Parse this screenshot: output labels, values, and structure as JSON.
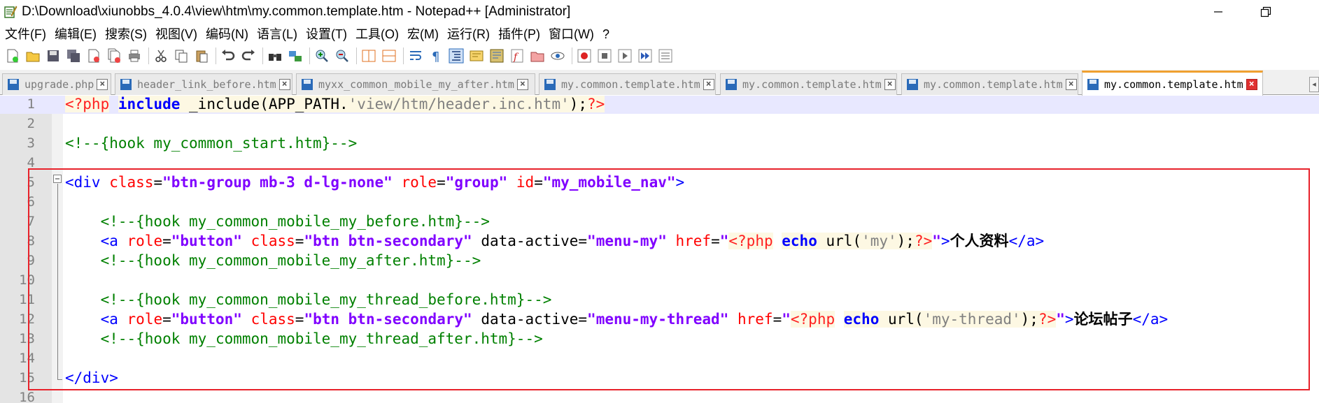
{
  "window": {
    "title": "D:\\Download\\xiunobbs_4.0.4\\view\\htm\\my.common.template.htm - Notepad++ [Administrator]"
  },
  "menu": [
    {
      "label": "文件(F)"
    },
    {
      "label": "编辑(E)"
    },
    {
      "label": "搜索(S)"
    },
    {
      "label": "视图(V)"
    },
    {
      "label": "编码(N)"
    },
    {
      "label": "语言(L)"
    },
    {
      "label": "设置(T)"
    },
    {
      "label": "工具(O)"
    },
    {
      "label": "宏(M)"
    },
    {
      "label": "运行(R)"
    },
    {
      "label": "插件(P)"
    },
    {
      "label": "窗口(W)"
    },
    {
      "label": "?"
    }
  ],
  "tabs": [
    {
      "label": "upgrade.php"
    },
    {
      "label": "header_link_before.htm"
    },
    {
      "label": "myxx_common_mobile_my_after.htm"
    },
    {
      "label": "my.common.template.htm"
    },
    {
      "label": "my.common.template.htm"
    },
    {
      "label": "my.common.template.htm"
    },
    {
      "label": "my.common.template.htm"
    }
  ],
  "tab_close_glyph": "×",
  "tab_scroll_glyph": "◂",
  "editor": {
    "current_line": 1,
    "lines": [
      {
        "num": "1",
        "tokens": [
          {
            "t": "php",
            "v": "<?php"
          },
          {
            "t": "plain",
            "v": " "
          },
          {
            "t": "kw",
            "v": "include"
          },
          {
            "t": "fn",
            "v": " _include"
          },
          {
            "t": "paren",
            "v": "("
          },
          {
            "t": "fn",
            "v": "APP_PATH"
          },
          {
            "t": "paren",
            "v": "."
          },
          {
            "t": "str",
            "v": "'view/htm/header.inc.htm'"
          },
          {
            "t": "paren",
            "v": ");"
          },
          {
            "t": "php",
            "v": "?>"
          }
        ]
      },
      {
        "num": "2",
        "tokens": []
      },
      {
        "num": "3",
        "tokens": [
          {
            "t": "cmt",
            "v": "<!--{hook my_common_start.htm}-->"
          }
        ]
      },
      {
        "num": "4",
        "tokens": []
      },
      {
        "num": "5",
        "tokens": [
          {
            "t": "tag",
            "v": "<div"
          },
          {
            "t": "plain",
            "v": " "
          },
          {
            "t": "attr",
            "v": "class"
          },
          {
            "t": "eq",
            "v": "="
          },
          {
            "t": "val",
            "v": "\"btn-group mb-3 d-lg-none\""
          },
          {
            "t": "plain",
            "v": " "
          },
          {
            "t": "attr",
            "v": "role"
          },
          {
            "t": "eq",
            "v": "="
          },
          {
            "t": "val",
            "v": "\"group\""
          },
          {
            "t": "plain",
            "v": " "
          },
          {
            "t": "attr",
            "v": "id"
          },
          {
            "t": "eq",
            "v": "="
          },
          {
            "t": "val",
            "v": "\"my_mobile_nav\""
          },
          {
            "t": "tag",
            "v": ">"
          }
        ]
      },
      {
        "num": "6",
        "tokens": []
      },
      {
        "num": "7",
        "tokens": [
          {
            "t": "plain",
            "v": "    "
          },
          {
            "t": "cmt",
            "v": "<!--{hook my_common_mobile_my_before.htm}-->"
          }
        ]
      },
      {
        "num": "8",
        "tokens": [
          {
            "t": "plain",
            "v": "    "
          },
          {
            "t": "tag",
            "v": "<a"
          },
          {
            "t": "plain",
            "v": " "
          },
          {
            "t": "attr",
            "v": "role"
          },
          {
            "t": "eq",
            "v": "="
          },
          {
            "t": "val",
            "v": "\"button\""
          },
          {
            "t": "plain",
            "v": " "
          },
          {
            "t": "attr",
            "v": "class"
          },
          {
            "t": "eq",
            "v": "="
          },
          {
            "t": "val",
            "v": "\"btn btn-secondary\""
          },
          {
            "t": "plain",
            "v": " data-active"
          },
          {
            "t": "eq",
            "v": "="
          },
          {
            "t": "val",
            "v": "\"menu-my\""
          },
          {
            "t": "plain",
            "v": " "
          },
          {
            "t": "attr",
            "v": "href"
          },
          {
            "t": "eq",
            "v": "="
          },
          {
            "t": "val",
            "v": "\""
          },
          {
            "t": "php",
            "v": "<?php"
          },
          {
            "t": "plain",
            "v": " "
          },
          {
            "t": "kw",
            "v": "echo"
          },
          {
            "t": "fn",
            "v": " url"
          },
          {
            "t": "paren",
            "v": "("
          },
          {
            "t": "str",
            "v": "'my'"
          },
          {
            "t": "paren",
            "v": ");"
          },
          {
            "t": "php",
            "v": "?>"
          },
          {
            "t": "val",
            "v": "\""
          },
          {
            "t": "tag",
            "v": ">"
          },
          {
            "t": "txt",
            "v": "个人资料"
          },
          {
            "t": "tag",
            "v": "</a>"
          }
        ]
      },
      {
        "num": "9",
        "tokens": [
          {
            "t": "plain",
            "v": "    "
          },
          {
            "t": "cmt",
            "v": "<!--{hook my_common_mobile_my_after.htm}-->"
          }
        ]
      },
      {
        "num": "10",
        "tokens": []
      },
      {
        "num": "11",
        "tokens": [
          {
            "t": "plain",
            "v": "    "
          },
          {
            "t": "cmt",
            "v": "<!--{hook my_common_mobile_my_thread_before.htm}-->"
          }
        ]
      },
      {
        "num": "12",
        "tokens": [
          {
            "t": "plain",
            "v": "    "
          },
          {
            "t": "tag",
            "v": "<a"
          },
          {
            "t": "plain",
            "v": " "
          },
          {
            "t": "attr",
            "v": "role"
          },
          {
            "t": "eq",
            "v": "="
          },
          {
            "t": "val",
            "v": "\"button\""
          },
          {
            "t": "plain",
            "v": " "
          },
          {
            "t": "attr",
            "v": "class"
          },
          {
            "t": "eq",
            "v": "="
          },
          {
            "t": "val",
            "v": "\"btn btn-secondary\""
          },
          {
            "t": "plain",
            "v": " data-active"
          },
          {
            "t": "eq",
            "v": "="
          },
          {
            "t": "val",
            "v": "\"menu-my-thread\""
          },
          {
            "t": "plain",
            "v": " "
          },
          {
            "t": "attr",
            "v": "href"
          },
          {
            "t": "eq",
            "v": "="
          },
          {
            "t": "val",
            "v": "\""
          },
          {
            "t": "php",
            "v": "<?php"
          },
          {
            "t": "plain",
            "v": " "
          },
          {
            "t": "kw",
            "v": "echo"
          },
          {
            "t": "fn",
            "v": " url"
          },
          {
            "t": "paren",
            "v": "("
          },
          {
            "t": "str",
            "v": "'my-thread'"
          },
          {
            "t": "paren",
            "v": ");"
          },
          {
            "t": "php",
            "v": "?>"
          },
          {
            "t": "val",
            "v": "\""
          },
          {
            "t": "tag",
            "v": ">"
          },
          {
            "t": "txt",
            "v": "论坛帖子"
          },
          {
            "t": "tag",
            "v": "</a>"
          }
        ]
      },
      {
        "num": "13",
        "tokens": [
          {
            "t": "plain",
            "v": "    "
          },
          {
            "t": "cmt",
            "v": "<!--{hook my_common_mobile_my_thread_after.htm}-->"
          }
        ]
      },
      {
        "num": "14",
        "tokens": []
      },
      {
        "num": "15",
        "tokens": [
          {
            "t": "tag",
            "v": "</div>"
          }
        ]
      },
      {
        "num": "16",
        "tokens": []
      }
    ]
  },
  "colors": {
    "highlight_box": "#e8222b",
    "active_tab_accent": "#f0a030",
    "current_line_bg": "#e8e8ff"
  }
}
